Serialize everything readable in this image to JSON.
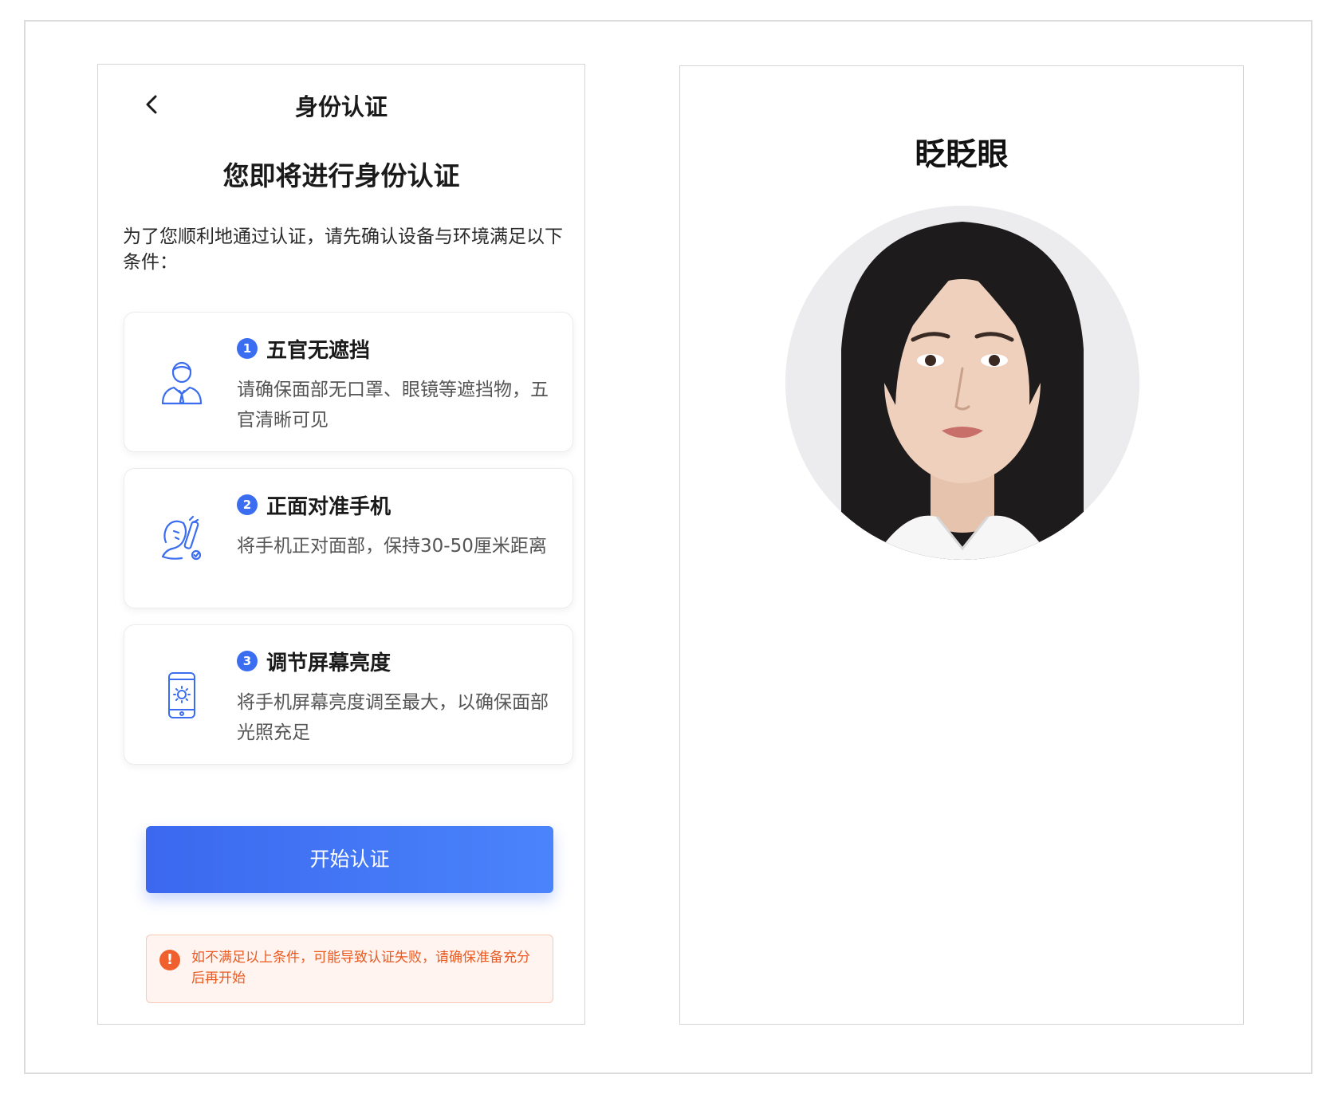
{
  "phone": {
    "nav_title": "身份认证",
    "heading": "您即将进行身份认证",
    "intro": "为了您顺利地通过认证，请先确认设备与环境满足以下条件：",
    "cards": [
      {
        "number": "1",
        "title": "五官无遮挡",
        "description": "请确保面部无口罩、眼镜等遮挡物，五官清晰可见",
        "icon": "person-icon"
      },
      {
        "number": "2",
        "title": "正面对准手机",
        "description": "将手机正对面部，保持30-50厘米距离",
        "icon": "face-phone-icon"
      },
      {
        "number": "3",
        "title": "调节屏幕亮度",
        "description": "将手机屏幕亮度调至最大，以确保面部光照充足",
        "icon": "phone-brightness-icon"
      }
    ],
    "start_button": "开始认证",
    "warning_icon": "!",
    "warning_text": "如不满足以上条件，可能导致认证失败，请确保准备充分后再开始"
  },
  "right": {
    "title": "眨眨眼"
  },
  "colors": {
    "accent": "#3a6df0",
    "warning": "#ea5a22",
    "warning_bg": "#fff4ef"
  }
}
